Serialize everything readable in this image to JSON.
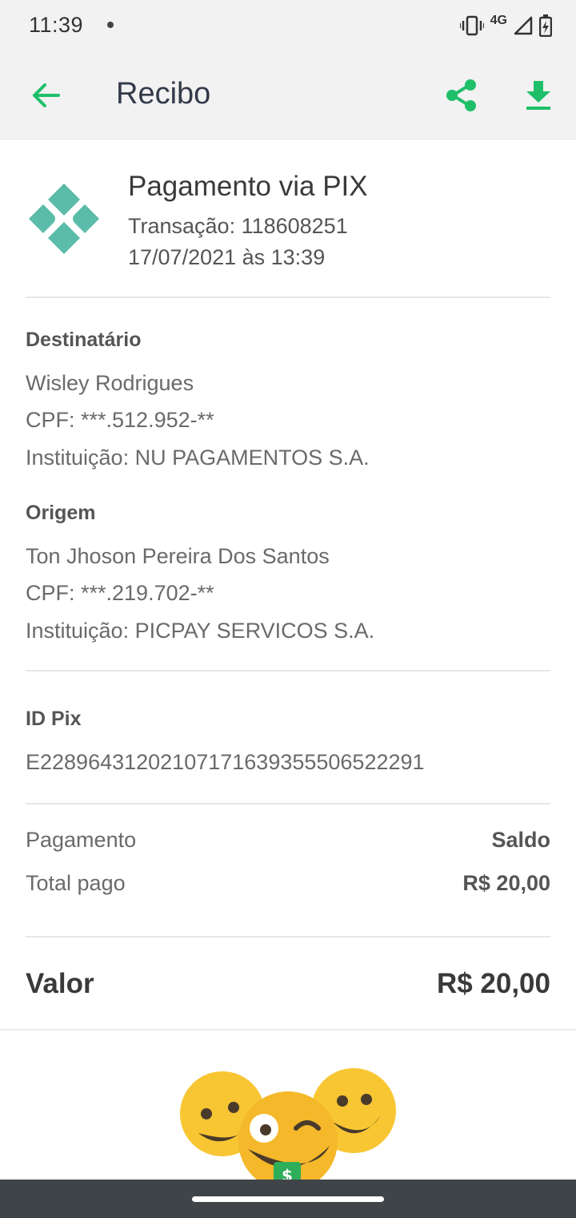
{
  "status_bar": {
    "time": "11:39",
    "network": "4G"
  },
  "app_bar": {
    "title": "Recibo"
  },
  "header": {
    "title": "Pagamento via PIX",
    "transaction": "Transação: 118608251",
    "datetime": "17/07/2021 às 13:39"
  },
  "destinatario": {
    "label": "Destinatário",
    "name": "Wisley Rodrigues",
    "cpf": "CPF: ***.512.952-**",
    "institution": "Instituição: NU PAGAMENTOS S.A."
  },
  "origem": {
    "label": "Origem",
    "name": "Ton Jhoson Pereira Dos Santos",
    "cpf": "CPF: ***.219.702-**",
    "institution": "Instituição: PICPAY SERVICOS S.A."
  },
  "pix": {
    "label": "ID Pix",
    "id": "E22896431202107171639355506522291"
  },
  "summary": {
    "payment_label": "Pagamento",
    "payment_value": "Saldo",
    "total_label": "Total pago",
    "total_value": "R$ 20,00"
  },
  "valor": {
    "label": "Valor",
    "value": "R$ 20,00"
  },
  "colors": {
    "accent": "#1fbf6a",
    "pix": "#5bbcaa",
    "emoji": "#f7c632"
  },
  "icons": [
    "back-arrow-icon",
    "share-icon",
    "download-icon",
    "pix-logo-icon",
    "emoji-icon"
  ]
}
